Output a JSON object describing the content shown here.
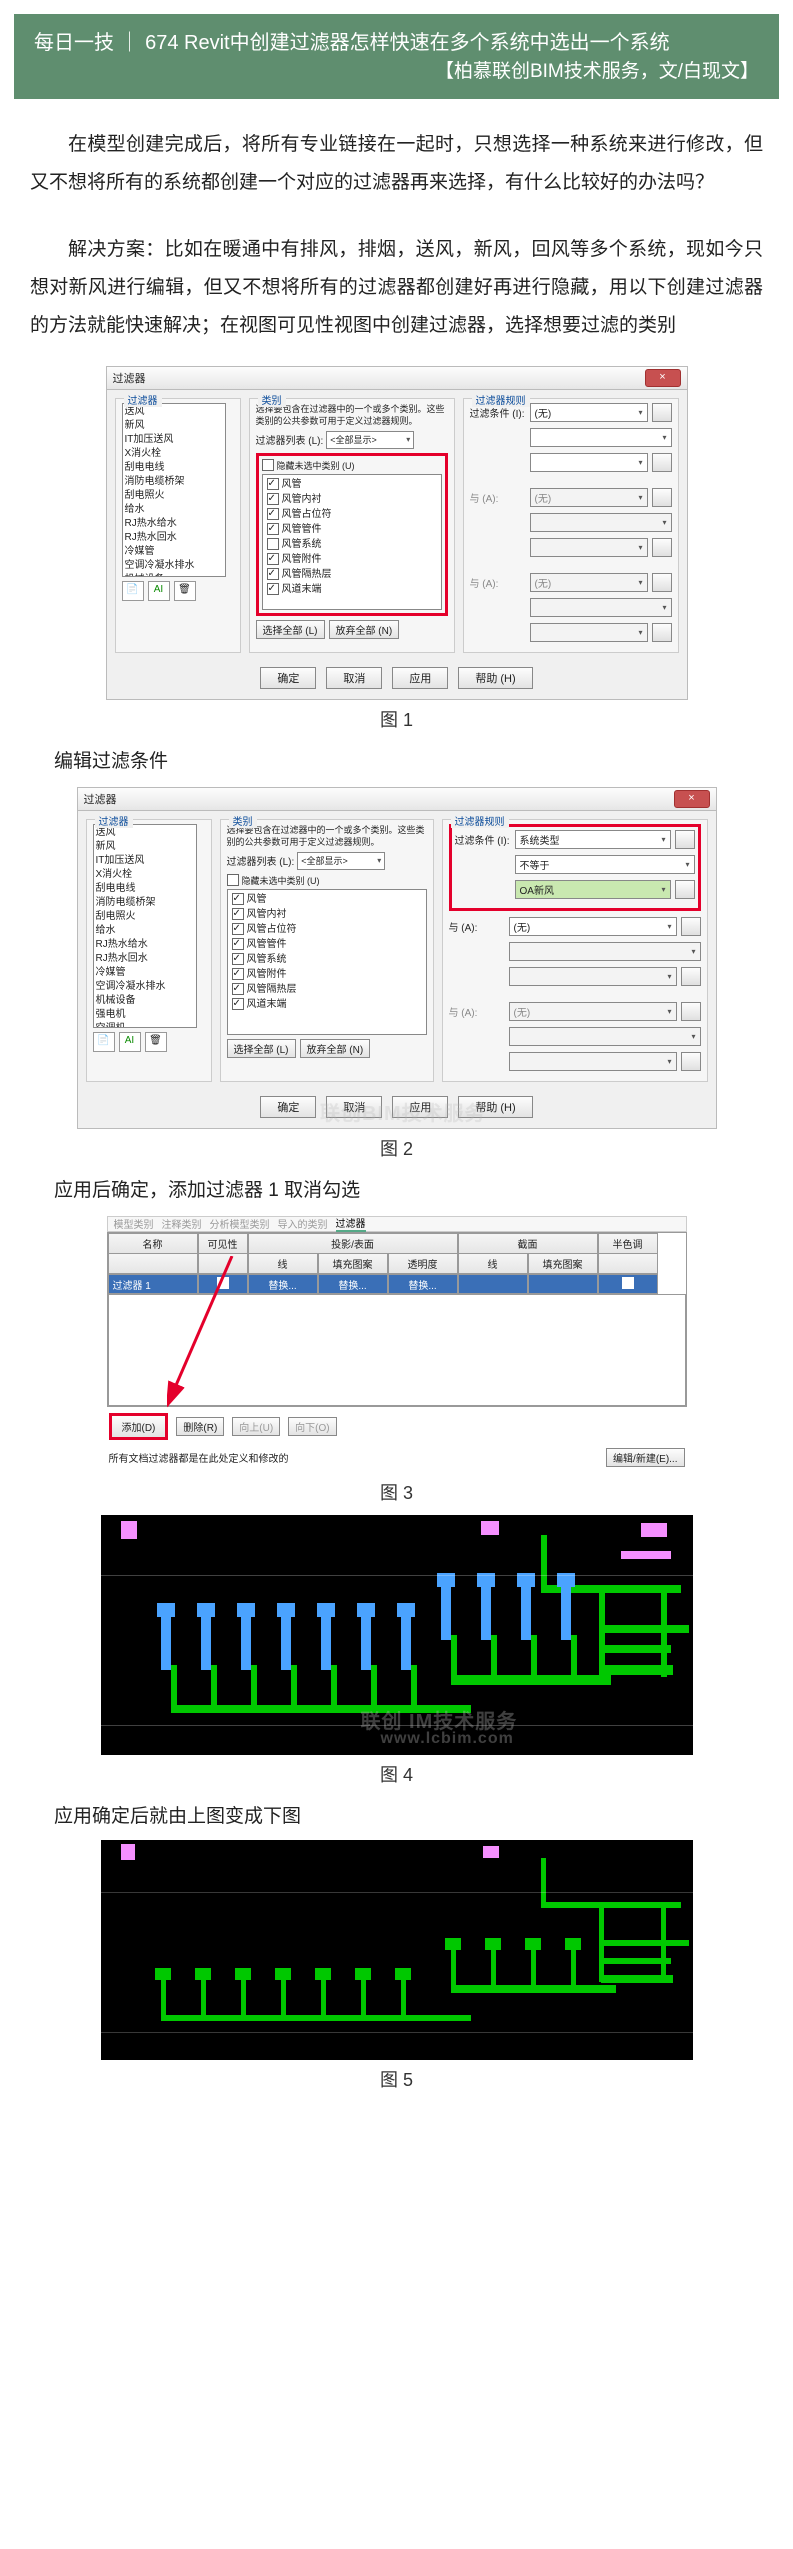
{
  "header": {
    "title": "每日一技 ｜ 674 Revit中创建过滤器怎样快速在多个系统中选出一个系统",
    "subtitle": "【柏慕联创BIM技术服务，文/白现文】"
  },
  "paragraphs": {
    "p1": "在模型创建完成后，将所有专业链接在一起时，只想选择一种系统来进行修改，但又不想将所有的系统都创建一个对应的过滤器再来选择，有什么比较好的办法吗？",
    "p2": "解决方案：比如在暖通中有排风，排烟，送风，新风，回风等多个系统，现如今只想对新风进行编辑，但又不想将所有的过滤器都创建好再进行隐藏，用以下创建过滤器的方法就能快速解决；在视图可见性视图中创建过滤器，选择想要过滤的类别"
  },
  "captions": {
    "c1": "图 1",
    "c2": "图 2",
    "c3": "图 3",
    "c4": "图 4",
    "c5": "图 5"
  },
  "subheads": {
    "s1": "编辑过滤条件",
    "s2": "应用后确定，添加过滤器 1 取消勾选",
    "s3": "应用确定后就由上图变成下图"
  },
  "dialog": {
    "title": "过滤器",
    "close": "×",
    "panel_filter": "过滤器",
    "panel_categories": "类别",
    "panel_rules": "过滤器规则",
    "filter_items": [
      "送风",
      "新风",
      "IT加压送风",
      "X消火栓",
      "刮电电线",
      "消防电缆桥架",
      "刮电照火",
      "给水",
      "RJ热水给水",
      "RJ热水回水",
      "冷媒管",
      "空调冷凝水排水",
      "机械设备",
      "强电机",
      "空调机",
      "过滤器 1"
    ],
    "cat_desc": "选择要包含在过滤器中的一个或多个类别。这些类别的公共参数可用于定义过滤器规则。",
    "cat_combo_label": "过滤器列表 (L):",
    "cat_combo_value": "<全部显示>",
    "hide_unchecked": "隐藏未选中类别 (U)",
    "cat_items": [
      "风管",
      "风管内衬",
      "风管占位符",
      "风管管件",
      "风管系统",
      "风管附件",
      "风管隔热层",
      "风道末端"
    ],
    "cat_checked1": [
      true,
      true,
      true,
      true,
      false,
      true,
      true,
      true
    ],
    "cat_checked2": [
      true,
      true,
      true,
      true,
      true,
      true,
      true,
      true
    ],
    "btn_select_all": "选择全部 (L)",
    "btn_deselect_all": "放弃全部 (N)",
    "rule_label": "过滤条件 (I):",
    "rule_none": "(无)",
    "rule_and": "与 (A):",
    "rule2_a": "系统类型",
    "rule2_b": "不等于",
    "rule2_c": "OA新风",
    "btn_ok": "确定",
    "btn_cancel": "取消",
    "btn_apply": "应用",
    "btn_help": "帮助 (H)"
  },
  "fig3": {
    "tabs": [
      "模型类别",
      "注释类别",
      "分析模型类别",
      "导入的类别",
      "过滤器"
    ],
    "hdr_name": "名称",
    "hdr_vis": "可见性",
    "hdr_proj": "投影/表面",
    "hdr_line": "线",
    "hdr_fill": "填充图案",
    "hdr_trans": "透明度",
    "hdr_cut": "截面",
    "hdr_cline": "线",
    "hdr_cfill": "填充图案",
    "hdr_half": "半色调",
    "row_name": "过滤器 1",
    "row_override": "替换...",
    "btn_add": "添加(D)",
    "btn_remove": "删除(R)",
    "btn_up": "向上(U)",
    "btn_down": "向下(O)",
    "btn_edit": "编辑/新建(E)...",
    "note": "所有文档过滤器都是在此处定义和修改的"
  },
  "watermark": {
    "line1": "联创BIM技术服务",
    "line1b": "联创 IM技术服务",
    "line2": "www.lcbim.com"
  }
}
